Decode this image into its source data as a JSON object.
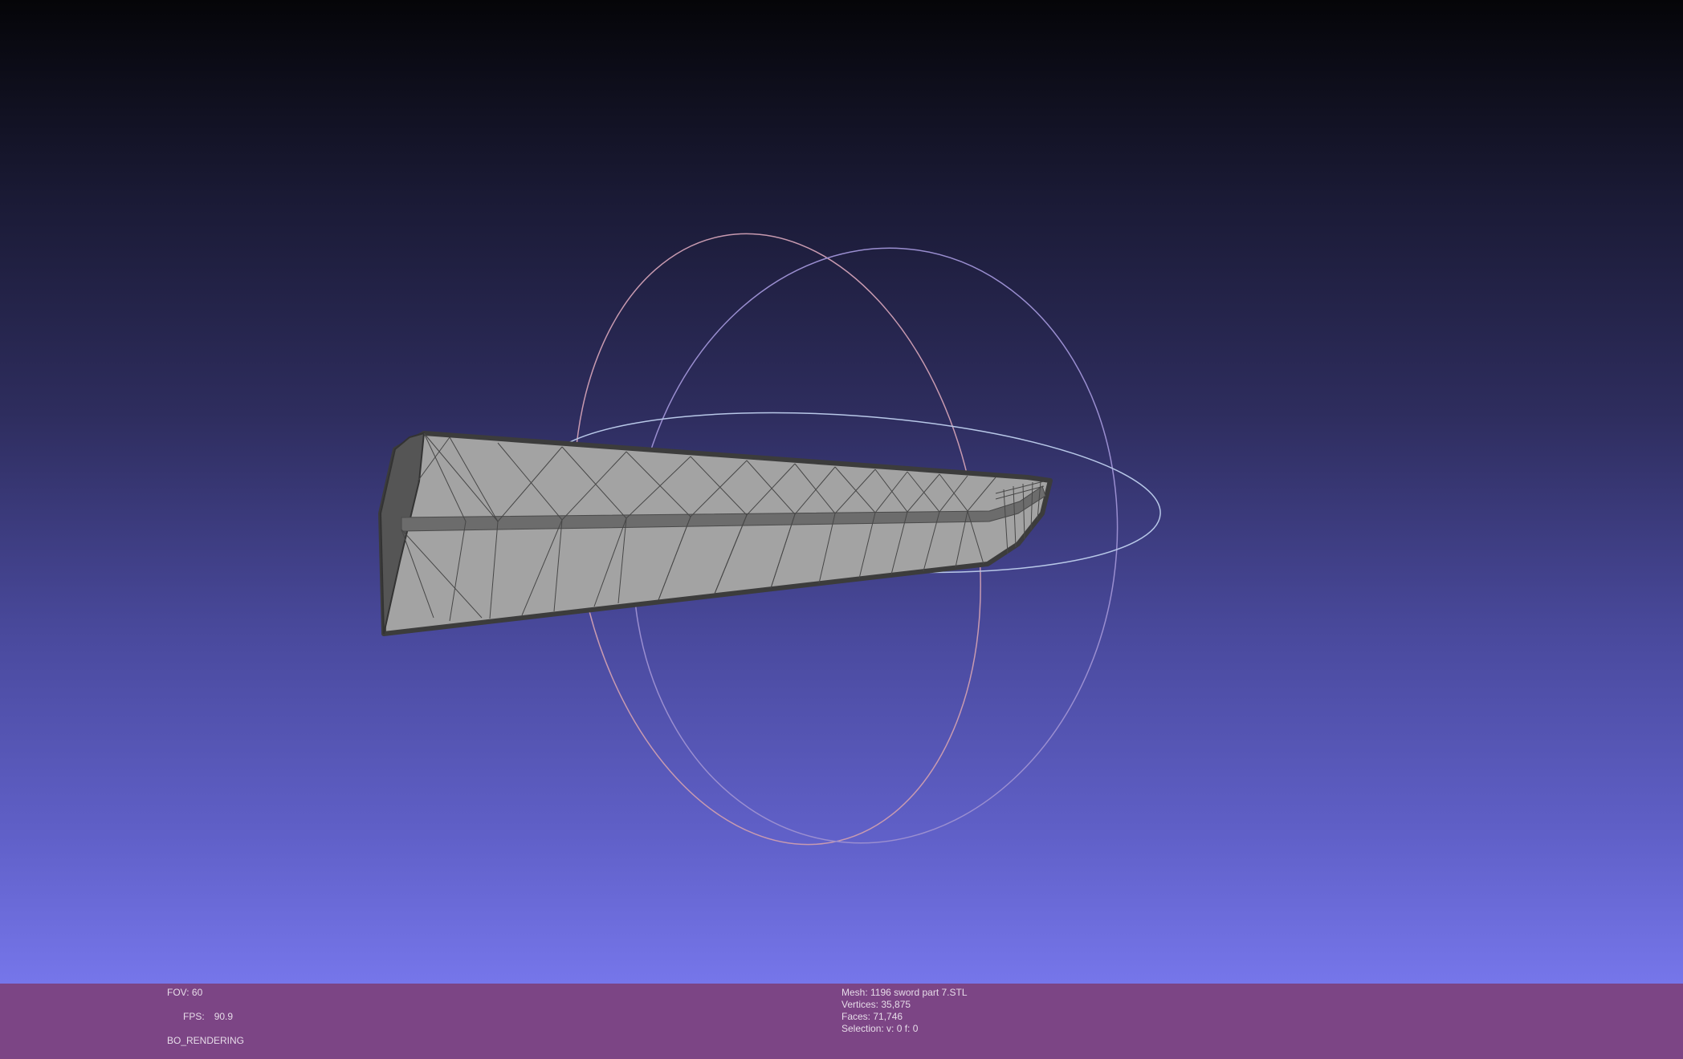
{
  "viewport": {
    "object": "3D mesh of a sword blade segment rendered with wireframe edges",
    "trackball": "rotation trackball circles"
  },
  "info_left": {
    "fov": "FOV: 60",
    "fps_label": "FPS:",
    "fps_value": "90.9",
    "render_mode": "BO_RENDERING"
  },
  "info_right": {
    "mesh": "Mesh: 1196 sword part 7.STL",
    "vertices": "Vertices: 35,875",
    "faces": "Faces: 71,746",
    "selection": "Selection: v: 0 f: 0"
  },
  "colors": {
    "info_bar": "#7c4585",
    "mesh_fill": "#a3a3a3",
    "mesh_edge": "#3a3a3a"
  }
}
